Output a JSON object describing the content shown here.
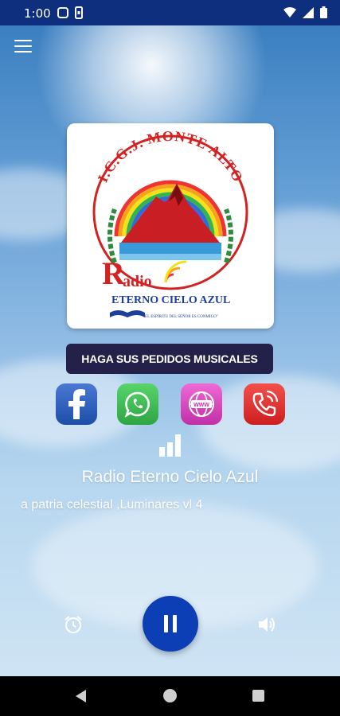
{
  "status_bar": {
    "time": "1:00"
  },
  "app": {
    "logo": {
      "arc_text": "I.C.G.J. MONTE ALTO",
      "radio_word": "adio",
      "radio_initial": "R",
      "subtitle": "ETERNO CIELO AZUL",
      "motto": "\"EL ESPÍRITU DEL SEÑOR ES CONMIGO\""
    },
    "request_button_label": "HAGA SUS PEDIDOS MUSICALES",
    "social": [
      {
        "name": "facebook-icon"
      },
      {
        "name": "whatsapp-icon"
      },
      {
        "name": "website-icon",
        "label": "WWW"
      },
      {
        "name": "phone-icon"
      }
    ],
    "station_name": "Radio Eterno Cielo Azul",
    "now_playing": "a patria celestial ,Luminares vl 4"
  },
  "colors": {
    "status_bar": "#0d2f7d",
    "play_button": "#0c3fb6",
    "request_button": "#23204a",
    "logo_red": "#d32222"
  }
}
